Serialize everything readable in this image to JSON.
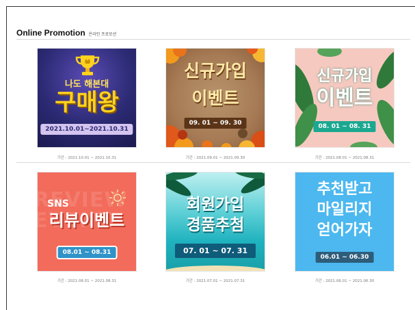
{
  "header": {
    "title": "Online Promotion",
    "subtitle": "온라인 프로모션"
  },
  "promotions": [
    {
      "line1": "나도 해본대",
      "line2": "구매왕",
      "period": "2021.10.01~2021.10.31",
      "caption": "기간 : 2021.10.01 ~ 2021.10.31",
      "icon": "trophy-icon"
    },
    {
      "line1": "신규가입",
      "line2": "이벤트",
      "period": "09. 01 ~ 09. 30",
      "caption": "기간 : 2021.09.01 ~ 2021.09.30"
    },
    {
      "line1": "신규가입",
      "line2": "이벤트",
      "period": "08. 01 ~ 08. 31",
      "caption": "기간 : 2021.08.01 ~ 2021.08.31"
    },
    {
      "tag": "SNS",
      "line1": "리뷰이벤트",
      "period": "08.01 ~ 08.31",
      "caption": "기간 : 2021.08.01 ~ 2021.08.31",
      "bg_text": "REVIEW EVENT"
    },
    {
      "line1": "회원가입",
      "line2": "경품추첨",
      "period": "07. 01 ~ 07. 31",
      "caption": "기간 : 2021.07.01 ~ 2021.07.31"
    },
    {
      "line1": "추천받고",
      "line2": "마일리지",
      "line3": "얻어가자",
      "period": "06.01 ~ 06.30",
      "caption": "기간 : 2021.06.01 ~ 2021.06.30"
    }
  ],
  "colors": {
    "card1_bg": "#2b2a73",
    "card1_text": "#ffd21f",
    "card2_bg": "#a67b55",
    "card2_text": "#ffe9a8",
    "card3_bg": "#f6c9c0",
    "card3_pill": "#1ba891",
    "card4_bg": "#f26b5b",
    "card4_pill": "#2f93c8",
    "card5_bg": "#23b8c4",
    "card5_pill": "#0f5b7a",
    "card6_bg": "#4cb8ef",
    "card6_pill": "#2d5d7a"
  }
}
